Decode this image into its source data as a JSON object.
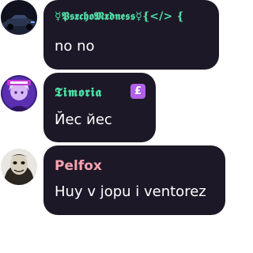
{
  "messages": [
    {
      "author": "☿𝕻𝖘𝖝𝖈𝖍𝖔𝕸𝖝𝖉𝖓𝖊𝖘𝖘☿{</> {",
      "author_color": "#4fe0a8",
      "text": "no no"
    },
    {
      "author": "𝕿𝖎𝖒𝖔𝖗𝖎𝖆",
      "author_color": "#4fe0a8",
      "badge": "£",
      "badge_color": "#b061e8",
      "text": "Йес йес"
    },
    {
      "author": "Pelfox",
      "author_color": "#f7a2b0",
      "text": "Huy v jopu i ventorez"
    }
  ],
  "bubble_color": "#1d1827"
}
